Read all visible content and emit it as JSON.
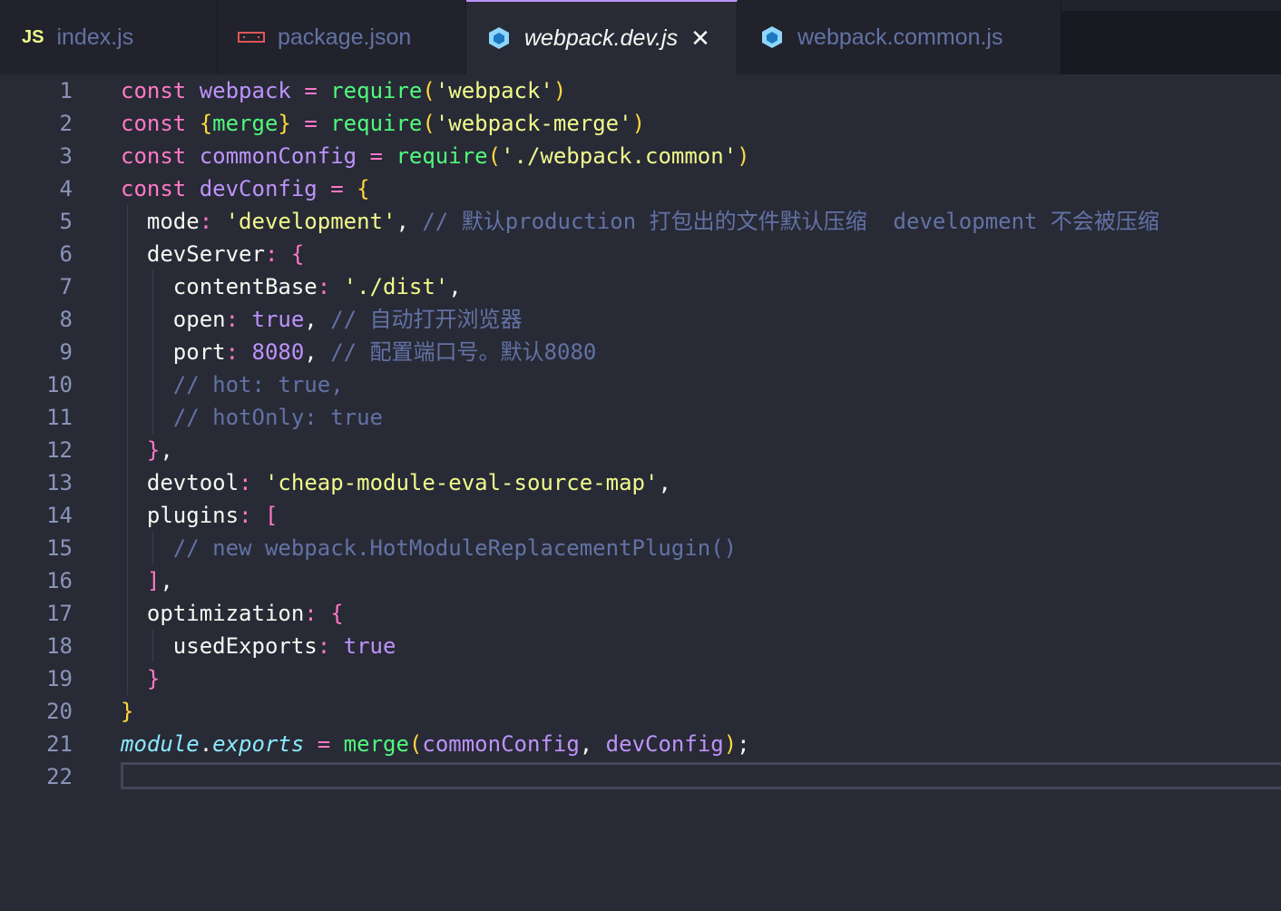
{
  "tabs": [
    {
      "label": "index.js",
      "icon": "js-icon"
    },
    {
      "label": "package.json",
      "icon": "npm-icon"
    },
    {
      "label": "webpack.dev.js",
      "icon": "webpack-icon",
      "active": true
    },
    {
      "label": "webpack.common.js",
      "icon": "webpack-icon"
    }
  ],
  "editor": {
    "line_numbers": [
      "1",
      "2",
      "3",
      "4",
      "5",
      "6",
      "7",
      "8",
      "9",
      "10",
      "11",
      "12",
      "13",
      "14",
      "15",
      "16",
      "17",
      "18",
      "19",
      "20",
      "21",
      "22"
    ],
    "l1": {
      "kw": "const",
      "var": "webpack",
      "eq": "=",
      "fn": "require",
      "open": "(",
      "str": "'webpack'",
      "close": ")"
    },
    "l2": {
      "kw": "const",
      "open_brace": "{",
      "var": "merge",
      "close_brace": "}",
      "eq": "=",
      "fn": "require",
      "open": "(",
      "str": "'webpack-merge'",
      "close": ")"
    },
    "l3": {
      "kw": "const",
      "var": "commonConfig",
      "eq": "=",
      "fn": "require",
      "open": "(",
      "str": "'./webpack.common'",
      "close": ")"
    },
    "l4": {
      "kw": "const",
      "var": "devConfig",
      "eq": "=",
      "brace": "{"
    },
    "l5": {
      "prop": "mode",
      "colon": ":",
      "str": "'development'",
      "comma": ",",
      "comment": "// 默认production 打包出的文件默认压缩  development 不会被压缩"
    },
    "l6": {
      "prop": "devServer",
      "colon": ":",
      "brace": "{"
    },
    "l7": {
      "prop": "contentBase",
      "colon": ":",
      "str": "'./dist'",
      "comma": ","
    },
    "l8": {
      "prop": "open",
      "colon": ":",
      "bool": "true",
      "comma": ",",
      "comment": "// 自动打开浏览器"
    },
    "l9": {
      "prop": "port",
      "colon": ":",
      "num": "8080",
      "comma": ",",
      "comment": "// 配置端口号。默认8080"
    },
    "l10": {
      "comment": "// hot: true,"
    },
    "l11": {
      "comment": "// hotOnly: true"
    },
    "l12": {
      "brace": "}",
      "comma": ","
    },
    "l13": {
      "prop": "devtool",
      "colon": ":",
      "str": "'cheap-module-eval-source-map'",
      "comma": ","
    },
    "l14": {
      "prop": "plugins",
      "colon": ":",
      "bracket": "["
    },
    "l15": {
      "comment": "// new webpack.HotModuleReplacementPlugin()"
    },
    "l16": {
      "bracket": "]",
      "comma": ","
    },
    "l17": {
      "prop": "optimization",
      "colon": ":",
      "brace": "{"
    },
    "l18": {
      "prop": "usedExports",
      "colon": ":",
      "bool": "true"
    },
    "l19": {
      "brace": "}"
    },
    "l20": {
      "brace": "}"
    },
    "l21": {
      "mod": "module",
      "dot": ".",
      "exports": "exports",
      "eq": "=",
      "fn": "merge",
      "open": "(",
      "arg1": "commonConfig",
      "comma": ",",
      "arg2": "devConfig",
      "close": ")",
      "semi": ";"
    }
  }
}
